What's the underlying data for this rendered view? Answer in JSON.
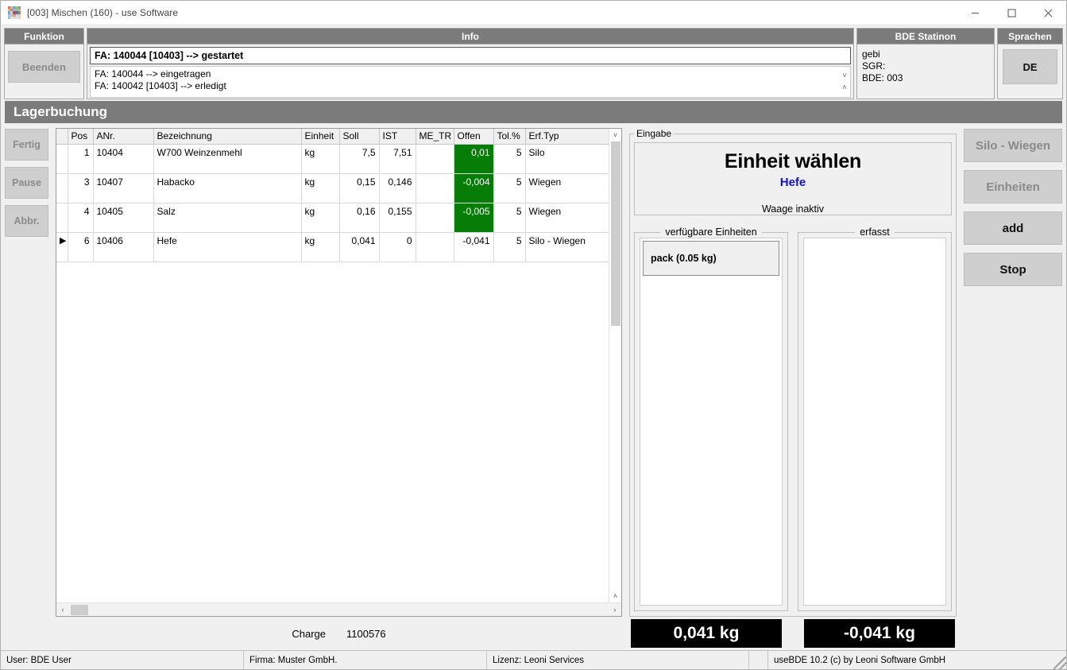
{
  "window": {
    "title": "[003] Mischen (160) - use Software",
    "icon": "app-grid-icon",
    "icon_colors": [
      "#e46a6a",
      "#e0c760",
      "#6fa8dc",
      "#8fce6b",
      "#c27ba0",
      "#f6b26b",
      "#76a5af",
      "#b4a7d6",
      "#93c47d",
      "#d5a6bd",
      "#6d9eeb",
      "#ffd966",
      "#a64d79",
      "#45818e",
      "#e06666",
      "#9fc5e8",
      "#b6d7a8",
      "#ea9999",
      "#d9d2e9",
      "#f9cb9c",
      "#a2c4c9",
      "#ffe599",
      "#cfe2f3",
      "#d9ead3",
      "#f4cccc"
    ],
    "minimize_label": "minimize",
    "maximize_label": "maximize",
    "close_label": "close"
  },
  "funktion": {
    "header": "Funktion",
    "beenden_label": "Beenden"
  },
  "info": {
    "header": "Info",
    "current": "FA: 140044 [10403] --> gestartet",
    "lines": [
      "FA: 140044 --> eingetragen",
      "FA: 140042 [10403] --> erledigt"
    ],
    "scroll_up": "▲",
    "scroll_down": "▼"
  },
  "bde": {
    "header": "BDE Statinon",
    "lines": [
      "gebi",
      "SGR:",
      "BDE: 003"
    ]
  },
  "sprachen": {
    "header": "Sprachen",
    "language_label": "DE"
  },
  "page": {
    "title": "Lagerbuchung"
  },
  "leftbar": {
    "buttons": [
      {
        "label": "Fertig",
        "disabled": true
      },
      {
        "label": "Pause",
        "disabled": true
      },
      {
        "label": "Abbr.",
        "disabled": true
      }
    ]
  },
  "table": {
    "columns": [
      "Pos",
      "ANr.",
      "Bezeichnung",
      "Einheit",
      "Soll",
      "IST",
      "ME_TR",
      "Offen",
      "Tol.%",
      "Erf.Typ"
    ],
    "rows": [
      {
        "marker": "",
        "pos": "1",
        "anr": "10404",
        "bezeichnung": "W700 Weinzenmehl",
        "einheit": "kg",
        "soll": "7,5",
        "ist": "7,51",
        "me_tr": "",
        "offen": "0,01",
        "offen_highlight": true,
        "tol": "5",
        "erftyp": "Silo"
      },
      {
        "marker": "",
        "pos": "3",
        "anr": "10407",
        "bezeichnung": "Habacko",
        "einheit": "kg",
        "soll": "0,15",
        "ist": "0,146",
        "me_tr": "",
        "offen": "-0,004",
        "offen_highlight": true,
        "tol": "5",
        "erftyp": "Wiegen"
      },
      {
        "marker": "",
        "pos": "4",
        "anr": "10405",
        "bezeichnung": "Salz",
        "einheit": "kg",
        "soll": "0,16",
        "ist": "0,155",
        "me_tr": "",
        "offen": "-0,005",
        "offen_highlight": true,
        "tol": "5",
        "erftyp": "Wiegen"
      },
      {
        "marker": "▶",
        "pos": "6",
        "anr": "10406",
        "bezeichnung": "Hefe",
        "einheit": "kg",
        "soll": "0,041",
        "ist": "0",
        "me_tr": "",
        "offen": "-0,041",
        "offen_highlight": false,
        "tol": "5",
        "erftyp": "Silo - Wiegen"
      }
    ],
    "highlight_color": "#067d06"
  },
  "charge": {
    "label": "Charge",
    "value": "1100576"
  },
  "eingabe": {
    "legend": "Eingabe",
    "display_title": "Einheit wählen",
    "display_subtitle": "Hefe",
    "display_subtitle_color": "#1212d6",
    "display_status": "Waage inaktiv",
    "available_legend": "verfügbare Einheiten",
    "available_items": [
      "pack (0.05 kg)"
    ],
    "captured_legend": "erfasst",
    "captured_items": []
  },
  "values": {
    "left": "0,041 kg",
    "right": "-0,041 kg"
  },
  "farright": {
    "buttons": [
      {
        "label": "Silo - Wiegen",
        "disabled": true
      },
      {
        "label": "Einheiten",
        "disabled": true
      },
      {
        "label": "add",
        "disabled": false
      },
      {
        "label": "Stop",
        "disabled": false
      }
    ]
  },
  "statusbar": {
    "user": "User: BDE User",
    "firma": "Firma: Muster GmbH.",
    "lizenz": "Lizenz: Leoni Services",
    "spacer": "",
    "copyright": "useBDE 10.2 (c) by Leoni Software GmbH"
  }
}
